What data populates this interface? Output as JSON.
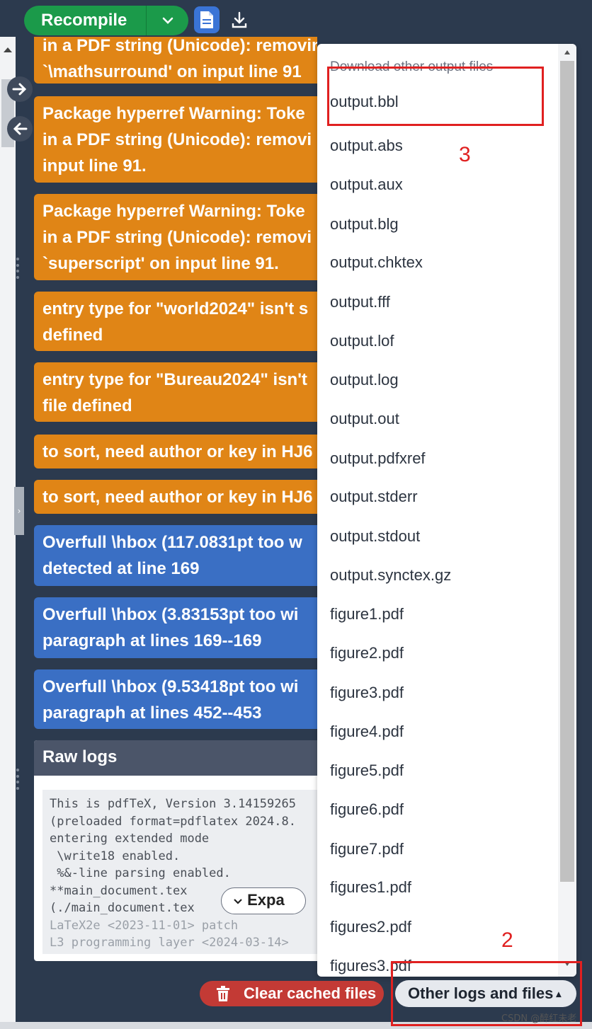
{
  "toolbar": {
    "recompile_label": "Recompile",
    "recompile_caret_icon": "chevron-down-icon",
    "pdf_icon": "document-icon",
    "download_icon": "download-icon"
  },
  "logs": {
    "entries": [
      {
        "type": "warning",
        "lines": [
          "in a PDF string (Unicode): removing",
          "`\\mathsurround' on input line 91"
        ]
      },
      {
        "type": "warning",
        "lines": [
          "Package hyperref Warning: Toke",
          "in a PDF string (Unicode): removi",
          "input line 91."
        ]
      },
      {
        "type": "warning",
        "lines": [
          "Package hyperref Warning: Toke",
          "in a PDF string (Unicode): removi",
          "`superscript' on input line 91."
        ]
      },
      {
        "type": "warning",
        "lines": [
          "entry type for \"world2024\" isn't s",
          "defined"
        ]
      },
      {
        "type": "warning",
        "lines": [
          "entry type for \"Bureau2024\" isn't",
          "file defined"
        ]
      },
      {
        "type": "warning",
        "lines": [
          "to sort, need author or key in HJ6"
        ]
      },
      {
        "type": "warning",
        "lines": [
          "to sort, need author or key in HJ6"
        ]
      },
      {
        "type": "info",
        "lines": [
          "Overfull \\hbox (117.0831pt too w",
          "detected at line 169"
        ]
      },
      {
        "type": "info",
        "lines": [
          "Overfull \\hbox (3.83153pt too wi",
          "paragraph at lines 169--169"
        ]
      },
      {
        "type": "info",
        "lines": [
          "Overfull \\hbox (9.53418pt too wi",
          "paragraph at lines 452--453"
        ]
      }
    ],
    "raw_logs_title": "Raw logs",
    "raw_lines": [
      "This is pdfTeX, Version 3.14159265",
      "(preloaded format=pdflatex 2024.8.",
      "entering extended mode",
      " \\write18 enabled.",
      " %&-line parsing enabled.",
      "**main_document.tex",
      "(./main_document.tex",
      "LaTeX2e <2023-11-01> patch",
      "L3 programming layer <2024-03-14>"
    ],
    "expand_label": "Expa"
  },
  "dropdown": {
    "header": "Download other output files",
    "items": [
      "output.bbl",
      "output.abs",
      "output.aux",
      "output.blg",
      "output.chktex",
      "output.fff",
      "output.lof",
      "output.log",
      "output.out",
      "output.pdfxref",
      "output.stderr",
      "output.stdout",
      "output.synctex.gz",
      "figure1.pdf",
      "figure2.pdf",
      "figure3.pdf",
      "figure4.pdf",
      "figure5.pdf",
      "figure6.pdf",
      "figure7.pdf",
      "figures1.pdf",
      "figures2.pdf",
      "figures3.pdf"
    ]
  },
  "bottom": {
    "clear_label": "Clear cached files",
    "other_label": "Other logs and files",
    "other_caret": "▴"
  },
  "annotations": {
    "step2": "2",
    "step3": "3",
    "color": "#e02020"
  },
  "watermark": "CSDN @醉红未老",
  "colors": {
    "warning": "#e08516",
    "info": "#3a6fc4",
    "recompile": "#1b9a4a",
    "danger": "#c33a35"
  }
}
